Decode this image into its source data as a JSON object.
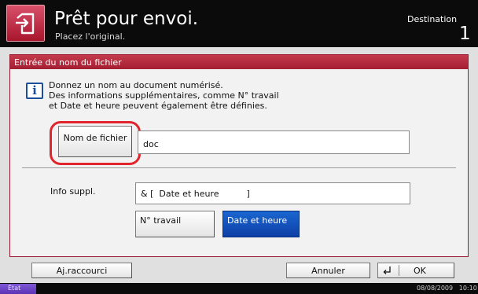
{
  "header": {
    "title": "Prêt pour envoi.",
    "subtitle": "Placez l'original.",
    "destination_label": "Destination",
    "destination_count": "1"
  },
  "section": {
    "title": "Entrée du nom du fichier",
    "info_lines": [
      "Donnez un nom au document numérisé.",
      "Des informations supplémentaires, comme N° travail",
      "et Date et heure peuvent également être définies."
    ]
  },
  "filename": {
    "button_label": "Nom de fichier",
    "value": "doc"
  },
  "info_suppl": {
    "label": "Info suppl.",
    "value": "& [  Date et heure          ]",
    "job_number_label": "N° travail",
    "date_time_label": "Date et heure"
  },
  "bottom": {
    "shortcut_label": "Aj.raccourci",
    "cancel_label": "Annuler",
    "ok_label": "OK"
  },
  "status": {
    "state_label": "État",
    "datetime": "08/08/2009   10:10"
  },
  "colors": {
    "accent_red": "#a41e31",
    "highlight_red": "#e0262c",
    "selected_blue": "#1a66d0",
    "status_purple": "#6a41c4"
  },
  "icons": {
    "home": "scanner-send-icon",
    "info": "info-icon",
    "ok": "enter-return-icon"
  }
}
